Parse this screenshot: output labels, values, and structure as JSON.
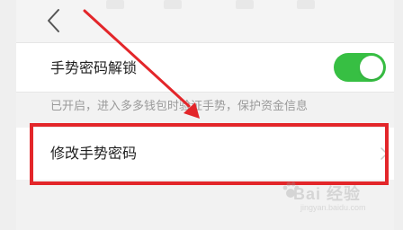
{
  "header": {
    "back_icon": "chevron-left-icon"
  },
  "settings": {
    "gesture_unlock": {
      "label": "手势密码解锁",
      "enabled": true,
      "switch_color": "#37bf43"
    },
    "hint": "已开启，进入多多钱包时验证手势，保护资金信息",
    "change_gesture": {
      "label": "修改手势密码",
      "chevron_icon": "chevron-right-icon"
    }
  },
  "annotation": {
    "highlight_color": "#e3262a"
  },
  "watermark": {
    "main": "Bai 经验",
    "sub": "jingyan.baidu.com"
  }
}
